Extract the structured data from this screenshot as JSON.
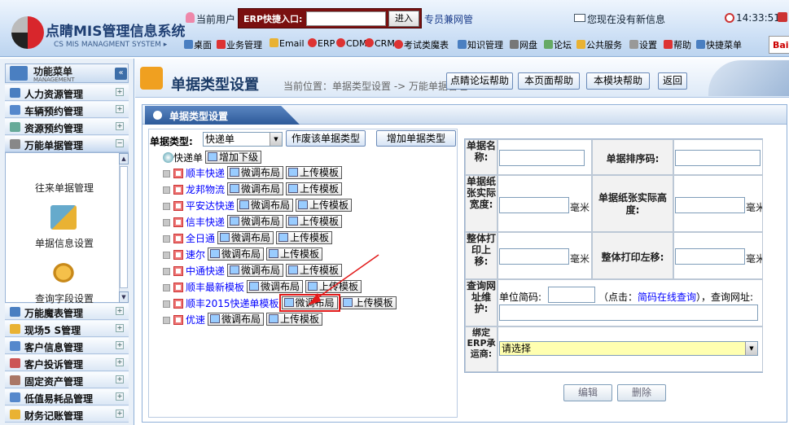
{
  "header": {
    "app_title": "点睛MIS管理信息系统",
    "app_subtitle": "CS MIS MANAGMENT SYSTEM ▸",
    "current_user_label": "当前用户",
    "erp_label": "ERP快捷入口:",
    "erp_input_value": "",
    "erp_button": "进入",
    "vip_text": "专员兼网管",
    "message_text": "您现在没有新信息",
    "clock": "14:33:51",
    "nav": [
      "桌面",
      "业务管理",
      "Email",
      "ERP",
      "CDM",
      "CRM",
      "考试类魔表",
      "知识管理",
      "网盘",
      "论坛",
      "公共服务",
      "设置",
      "帮助",
      "快捷菜单"
    ],
    "brand_button": "Bai"
  },
  "sidebar": {
    "title": "功能菜单",
    "subtitle": "MANAGEMENT",
    "collapse_icon": "«",
    "menu_top": [
      "人力资源管理",
      "车辆预约管理",
      "资源预约管理",
      "万能单据管理"
    ],
    "submenu": [
      "往来单据管理",
      "单据信息设置",
      "查询字段设置"
    ],
    "menu_bottom": [
      "万能魔表管理",
      "现场5 S管理",
      "客户信息管理",
      "客户投诉管理",
      "固定资产管理",
      "低值易耗品管理",
      "财务记账管理"
    ]
  },
  "main": {
    "page_title": "单据类型设置",
    "breadcrumb": "当前位置：单据类型设置 -> 万能单据管理",
    "toolbar": [
      "点睛论坛帮助",
      "本页面帮助",
      "本模块帮助",
      "返回"
    ],
    "panel_title": "单据类型设置",
    "type_label": "单据类型:",
    "type_value": "快递单",
    "discard_button": "作废该单据类型",
    "add_button": "增加单据类型",
    "tree_root": "快递单",
    "add_child_button": "增加下级",
    "adjust_label": "微调布局",
    "upload_label": "上传模板",
    "tree_items": [
      "顺丰快递",
      "龙邦物流",
      "平安达快递",
      "信丰快递",
      "全日通",
      "速尔",
      "中通快递",
      "顺丰最新模板",
      "顺丰2015快递单模板",
      "优速"
    ],
    "form": {
      "name_label": "单据名称:",
      "sort_label": "单据排序码:",
      "width_label": "单据纸张实际宽度:",
      "height_label": "单据纸张实际高度:",
      "unit": "毫米",
      "offset_top_label": "整体打印上移:",
      "offset_left_label": "整体打印左移:",
      "query_label": "查询网址维护:",
      "unit_code_label": "单位简码:",
      "hint_prefix": "（点击：",
      "hint_link": "简码在线查询",
      "hint_suffix": "），查询网址:",
      "carrier_label": "绑定ERP承运商:",
      "carrier_value": "请选择",
      "edit_button": "编辑",
      "delete_button": "删除"
    }
  }
}
